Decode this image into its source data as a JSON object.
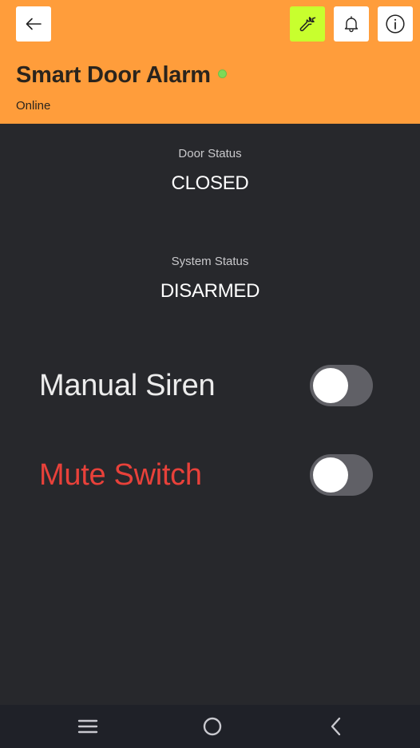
{
  "header": {
    "title": "Smart Door Alarm",
    "subtitle": "Online",
    "background_color": "#ff9d3b",
    "tools_button_color": "#c8ff2e",
    "online_dot_color": "#7ed957",
    "icons": [
      "arrow-left-icon",
      "wrench-icon",
      "bell-icon",
      "info-icon"
    ]
  },
  "door_status": {
    "label": "Door Status",
    "value": "CLOSED"
  },
  "system_status": {
    "label": "System Status",
    "value": "DISARMED"
  },
  "toggles": [
    {
      "label": "Manual Siren",
      "on": false,
      "label_color": "#ececec"
    },
    {
      "label": "Mute Switch",
      "on": false,
      "label_color": "#e8413a"
    }
  ],
  "navbar": {
    "icons": [
      "menu-icon",
      "home-circle-icon",
      "back-chevron-icon"
    ]
  }
}
